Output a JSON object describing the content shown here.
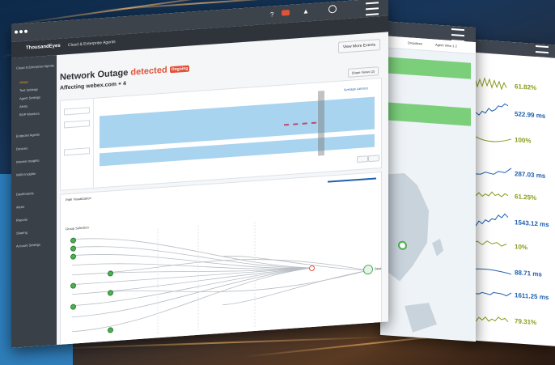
{
  "main": {
    "app_name": "ThousandEyes",
    "section": "Cloud & Enterprise Agents",
    "top_icons": [
      "help-icon",
      "notifications-icon",
      "alerts-icon",
      "user-icon"
    ],
    "view_more_label": "View More Events",
    "title_prefix": "Network Outage",
    "title_status": "detected",
    "badge": "Ongoing",
    "subtitle": "Affecting webex.com + 4",
    "share_label": "Share Views (2)",
    "sidebar_items": [
      "Cloud & Enterprise Agents",
      "Views",
      "Test Settings",
      "Agent Settings",
      "Alerts",
      "BGP Monitors",
      "Endpoint Agents",
      "Devices",
      "Internet Insights",
      "WAN Insights",
      "Dashboards",
      "Alerts",
      "Reports",
      "Sharing",
      "Account Settings"
    ],
    "chart_legend": "Average Latency",
    "path_section_label": "Path Visualization",
    "path_groups_label": "Group Selection",
    "destination_label": "Dest"
  },
  "middle": {
    "dropdown_a": "Dropdown",
    "dropdown_b": "Agent View 1 2"
  },
  "right": {
    "metrics": [
      {
        "value": "61.82%",
        "color": "#8a9a1a"
      },
      {
        "value": "522.99 ms",
        "color": "#1f5fae"
      },
      {
        "value": "100%",
        "color": "#8a9a1a"
      },
      {
        "value": "287.03 ms",
        "color": "#1f5fae"
      },
      {
        "value": "61.25%",
        "color": "#8a9a1a"
      },
      {
        "value": "1543.12 ms",
        "color": "#1f5fae"
      },
      {
        "value": "10%",
        "color": "#8a9a1a"
      },
      {
        "value": "88.71 ms",
        "color": "#1f5fae"
      },
      {
        "value": "1611.25 ms",
        "color": "#1f5fae"
      },
      {
        "value": "79.31%",
        "color": "#8a9a1a"
      }
    ]
  }
}
